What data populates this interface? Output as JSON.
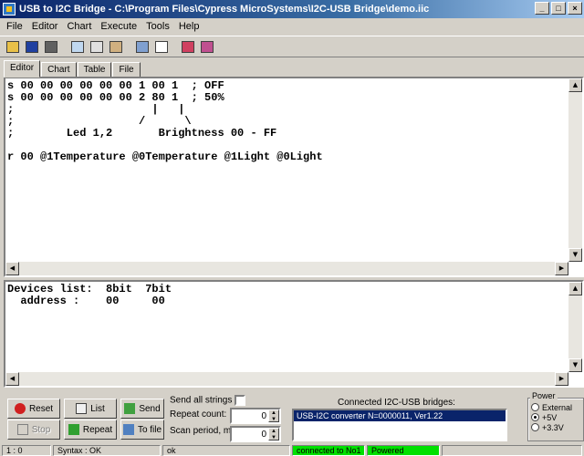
{
  "window": {
    "title": "USB to I2C Bridge - C:\\Program Files\\Cypress MicroSystems\\I2C-USB Bridge\\demo.iic",
    "buttons": [
      "_",
      "□",
      "×"
    ]
  },
  "menu": [
    "File",
    "Editor",
    "Chart",
    "Execute",
    "Tools",
    "Help"
  ],
  "toolbar": {
    "icons": [
      "open-icon",
      "save-icon",
      "settings-icon",
      "cut-icon",
      "copy-icon",
      "paste-icon",
      "find-icon",
      "window-icon",
      "chart-icon",
      "table-icon"
    ]
  },
  "tabs": [
    "Editor",
    "Chart",
    "Table",
    "File"
  ],
  "editor": {
    "text": "s 00 00 00 00 00 00 1 00 1  ; OFF\ns 00 00 00 00 00 00 2 80 1  ; 50%\n;                     |   |\n;                   /      \\\n;        Led 1,2       Brightness 00 - FF\n\nr 00 @1Temperature @0Temperature @1Light @0Light"
  },
  "output": {
    "text": "Devices list:  8bit  7bit\n  address :    00     00"
  },
  "controls": {
    "reset": "Reset",
    "list": "List",
    "send": "Send",
    "stop": "Stop",
    "repeat": "Repeat",
    "to_file": "To file",
    "send_all_strings": "Send all strings",
    "repeat_count_label": "Repeat count:",
    "repeat_count_value": "0",
    "scan_period_label": "Scan period, ms:",
    "scan_period_value": "0"
  },
  "bridges": {
    "label": "Connected I2C-USB bridges:",
    "items": [
      "USB-I2C converter N=0000011, Ver1.22"
    ]
  },
  "power": {
    "title": "Power",
    "options": [
      "External",
      "+5V",
      "+3.3V"
    ],
    "selected": "+5V"
  },
  "status": {
    "position": "1 : 0",
    "syntax": "Syntax : OK",
    "message": "ok",
    "connection": "connected to No1",
    "power": "Powered"
  },
  "colors": {
    "status_green": "#00e000",
    "selection": "#0a246a"
  }
}
